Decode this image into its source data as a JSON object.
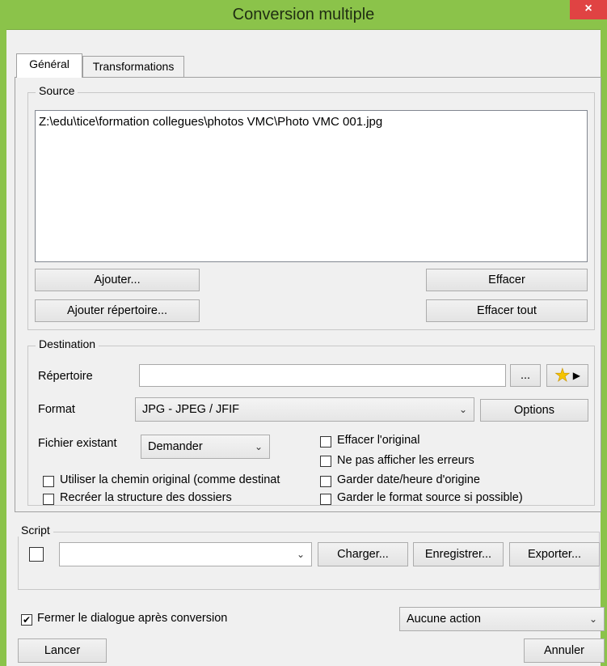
{
  "window": {
    "title": "Conversion multiple",
    "close_glyph": "×"
  },
  "tabs": [
    {
      "label": "Général",
      "active": true
    },
    {
      "label": "Transformations",
      "active": false
    }
  ],
  "source": {
    "group_label": "Source",
    "files": [
      "Z:\\edu\\tice\\formation collegues\\photos VMC\\Photo  VMC 001.jpg"
    ],
    "add_button": "Ajouter...",
    "add_folder_button": "Ajouter répertoire...",
    "delete_button": "Effacer",
    "delete_all_button": "Effacer tout"
  },
  "destination": {
    "group_label": "Destination",
    "folder_label": "Répertoire",
    "folder_value": "",
    "browse_button": "...",
    "format_label": "Format",
    "format_value": "JPG - JPEG / JFIF",
    "options_button": "Options",
    "existing_file_label": "Fichier existant",
    "existing_file_value": "Demander",
    "checkboxes_left": [
      {
        "label": "Utiliser la chemin original (comme destinat",
        "checked": false
      },
      {
        "label": "Recréer la structure des dossiers",
        "checked": false
      }
    ],
    "checkboxes_right": [
      {
        "label": "Effacer l'original",
        "checked": false
      },
      {
        "label": "Ne pas afficher les erreurs",
        "checked": false
      },
      {
        "label": "Garder date/heure d'origine",
        "checked": false
      },
      {
        "label": "Garder le format source si possible)",
        "checked": false
      }
    ]
  },
  "script": {
    "group_label": "Script",
    "enabled": false,
    "selected": "",
    "load_button": "Charger...",
    "save_button": "Enregistrer...",
    "export_button": "Exporter..."
  },
  "footer": {
    "close_after_label": "Fermer le dialogue après conversion",
    "close_after_checked": true,
    "action_value": "Aucune action",
    "start_button": "Lancer",
    "cancel_button": "Annuler"
  },
  "colors": {
    "title_bar": "#8bc34a",
    "close_button": "#e04343",
    "dialog_bg": "#f0f0f0"
  },
  "icons": {
    "favorite": "star-icon",
    "menu": "play-triangle-icon",
    "dropdown": "chevron-down-icon",
    "check": "checkmark-icon"
  }
}
